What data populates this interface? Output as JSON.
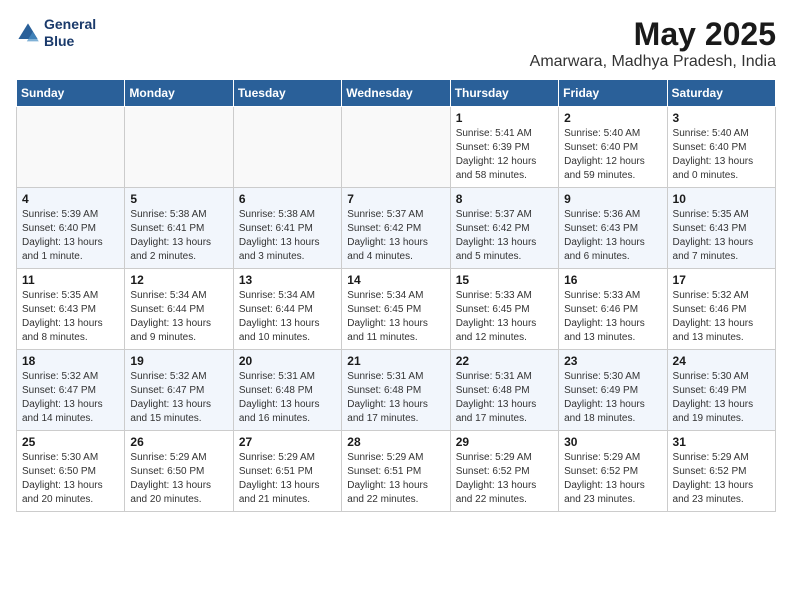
{
  "logo": {
    "line1": "General",
    "line2": "Blue"
  },
  "title": "May 2025",
  "subtitle": "Amarwara, Madhya Pradesh, India",
  "days_of_week": [
    "Sunday",
    "Monday",
    "Tuesday",
    "Wednesday",
    "Thursday",
    "Friday",
    "Saturday"
  ],
  "weeks": [
    [
      {
        "num": "",
        "info": ""
      },
      {
        "num": "",
        "info": ""
      },
      {
        "num": "",
        "info": ""
      },
      {
        "num": "",
        "info": ""
      },
      {
        "num": "1",
        "info": "Sunrise: 5:41 AM\nSunset: 6:39 PM\nDaylight: 12 hours\nand 58 minutes."
      },
      {
        "num": "2",
        "info": "Sunrise: 5:40 AM\nSunset: 6:40 PM\nDaylight: 12 hours\nand 59 minutes."
      },
      {
        "num": "3",
        "info": "Sunrise: 5:40 AM\nSunset: 6:40 PM\nDaylight: 13 hours\nand 0 minutes."
      }
    ],
    [
      {
        "num": "4",
        "info": "Sunrise: 5:39 AM\nSunset: 6:40 PM\nDaylight: 13 hours\nand 1 minute."
      },
      {
        "num": "5",
        "info": "Sunrise: 5:38 AM\nSunset: 6:41 PM\nDaylight: 13 hours\nand 2 minutes."
      },
      {
        "num": "6",
        "info": "Sunrise: 5:38 AM\nSunset: 6:41 PM\nDaylight: 13 hours\nand 3 minutes."
      },
      {
        "num": "7",
        "info": "Sunrise: 5:37 AM\nSunset: 6:42 PM\nDaylight: 13 hours\nand 4 minutes."
      },
      {
        "num": "8",
        "info": "Sunrise: 5:37 AM\nSunset: 6:42 PM\nDaylight: 13 hours\nand 5 minutes."
      },
      {
        "num": "9",
        "info": "Sunrise: 5:36 AM\nSunset: 6:43 PM\nDaylight: 13 hours\nand 6 minutes."
      },
      {
        "num": "10",
        "info": "Sunrise: 5:35 AM\nSunset: 6:43 PM\nDaylight: 13 hours\nand 7 minutes."
      }
    ],
    [
      {
        "num": "11",
        "info": "Sunrise: 5:35 AM\nSunset: 6:43 PM\nDaylight: 13 hours\nand 8 minutes."
      },
      {
        "num": "12",
        "info": "Sunrise: 5:34 AM\nSunset: 6:44 PM\nDaylight: 13 hours\nand 9 minutes."
      },
      {
        "num": "13",
        "info": "Sunrise: 5:34 AM\nSunset: 6:44 PM\nDaylight: 13 hours\nand 10 minutes."
      },
      {
        "num": "14",
        "info": "Sunrise: 5:34 AM\nSunset: 6:45 PM\nDaylight: 13 hours\nand 11 minutes."
      },
      {
        "num": "15",
        "info": "Sunrise: 5:33 AM\nSunset: 6:45 PM\nDaylight: 13 hours\nand 12 minutes."
      },
      {
        "num": "16",
        "info": "Sunrise: 5:33 AM\nSunset: 6:46 PM\nDaylight: 13 hours\nand 13 minutes."
      },
      {
        "num": "17",
        "info": "Sunrise: 5:32 AM\nSunset: 6:46 PM\nDaylight: 13 hours\nand 13 minutes."
      }
    ],
    [
      {
        "num": "18",
        "info": "Sunrise: 5:32 AM\nSunset: 6:47 PM\nDaylight: 13 hours\nand 14 minutes."
      },
      {
        "num": "19",
        "info": "Sunrise: 5:32 AM\nSunset: 6:47 PM\nDaylight: 13 hours\nand 15 minutes."
      },
      {
        "num": "20",
        "info": "Sunrise: 5:31 AM\nSunset: 6:48 PM\nDaylight: 13 hours\nand 16 minutes."
      },
      {
        "num": "21",
        "info": "Sunrise: 5:31 AM\nSunset: 6:48 PM\nDaylight: 13 hours\nand 17 minutes."
      },
      {
        "num": "22",
        "info": "Sunrise: 5:31 AM\nSunset: 6:48 PM\nDaylight: 13 hours\nand 17 minutes."
      },
      {
        "num": "23",
        "info": "Sunrise: 5:30 AM\nSunset: 6:49 PM\nDaylight: 13 hours\nand 18 minutes."
      },
      {
        "num": "24",
        "info": "Sunrise: 5:30 AM\nSunset: 6:49 PM\nDaylight: 13 hours\nand 19 minutes."
      }
    ],
    [
      {
        "num": "25",
        "info": "Sunrise: 5:30 AM\nSunset: 6:50 PM\nDaylight: 13 hours\nand 20 minutes."
      },
      {
        "num": "26",
        "info": "Sunrise: 5:29 AM\nSunset: 6:50 PM\nDaylight: 13 hours\nand 20 minutes."
      },
      {
        "num": "27",
        "info": "Sunrise: 5:29 AM\nSunset: 6:51 PM\nDaylight: 13 hours\nand 21 minutes."
      },
      {
        "num": "28",
        "info": "Sunrise: 5:29 AM\nSunset: 6:51 PM\nDaylight: 13 hours\nand 22 minutes."
      },
      {
        "num": "29",
        "info": "Sunrise: 5:29 AM\nSunset: 6:52 PM\nDaylight: 13 hours\nand 22 minutes."
      },
      {
        "num": "30",
        "info": "Sunrise: 5:29 AM\nSunset: 6:52 PM\nDaylight: 13 hours\nand 23 minutes."
      },
      {
        "num": "31",
        "info": "Sunrise: 5:29 AM\nSunset: 6:52 PM\nDaylight: 13 hours\nand 23 minutes."
      }
    ]
  ]
}
